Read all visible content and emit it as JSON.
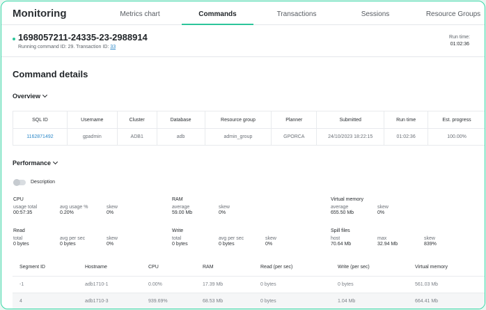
{
  "app": {
    "title": "Monitoring"
  },
  "tabs": [
    {
      "label": "Metrics chart",
      "active": false
    },
    {
      "label": "Commands",
      "active": true
    },
    {
      "label": "Transactions",
      "active": false
    },
    {
      "label": "Sessions",
      "active": false
    },
    {
      "label": "Resource Groups",
      "active": false
    }
  ],
  "command": {
    "id": "1698057211-24335-23-2988914",
    "subtitle_prefix": "Running command ID: 29. Transaction ID: ",
    "transaction_id": "33",
    "runtime_label": "Run time:",
    "runtime_value": "01:02:36"
  },
  "details": {
    "title": "Command details",
    "overview_label": "Overview",
    "performance_label": "Performance"
  },
  "overview": {
    "headers": [
      "SQL ID",
      "Username",
      "Cluster",
      "Database",
      "Resource group",
      "Planner",
      "Submitted",
      "Run time",
      "Est. progress"
    ],
    "row": [
      "1162871492",
      "gpadmin",
      "ADB1",
      "adb",
      "admin_group",
      "GPORCA",
      "24/10/2023 18:22:15",
      "01:02:36",
      "100.00%"
    ]
  },
  "toggle": {
    "label": "Description",
    "on": false
  },
  "performance": {
    "cpu": {
      "title": "CPU",
      "cols": [
        {
          "label": "usage total",
          "value": "00:57:35"
        },
        {
          "label": "avg usage %",
          "value": "0.20%"
        },
        {
          "label": "skew",
          "value": "0%"
        }
      ]
    },
    "ram": {
      "title": "RAM",
      "cols": [
        {
          "label": "average",
          "value": "59.00 Mb"
        },
        {
          "label": "skew",
          "value": "0%"
        }
      ]
    },
    "vmem": {
      "title": "Virtual memory",
      "cols": [
        {
          "label": "average",
          "value": "655.50 Mb"
        },
        {
          "label": "skew",
          "value": "0%"
        }
      ]
    },
    "read": {
      "title": "Read",
      "cols": [
        {
          "label": "total",
          "value": "0 bytes"
        },
        {
          "label": "avg per sec",
          "value": "0 bytes"
        },
        {
          "label": "skew",
          "value": "0%"
        }
      ]
    },
    "write": {
      "title": "Write",
      "cols": [
        {
          "label": "total",
          "value": "0 bytes"
        },
        {
          "label": "avg per sec",
          "value": "0 bytes"
        },
        {
          "label": "skew",
          "value": "0%"
        }
      ]
    },
    "spill": {
      "title": "Spill files",
      "cols": [
        {
          "label": "host",
          "value": "70.64 Mb"
        },
        {
          "label": "max",
          "value": "32.94 Mb"
        },
        {
          "label": "skew",
          "value": "839%"
        }
      ]
    }
  },
  "segments": {
    "headers": [
      "Segment ID",
      "Hostname",
      "CPU",
      "RAM",
      "Read (per sec)",
      "Write (per sec)",
      "Virtual memory"
    ],
    "rows": [
      [
        "-1",
        "adb1710-1",
        "0.00%",
        "17.39 Mb",
        "0 bytes",
        "0 bytes",
        "561.03 Mb"
      ],
      [
        "4",
        "adb1710-3",
        "939.69%",
        "68.53 Mb",
        "0 bytes",
        "1.04 Mb",
        "664.41 Mb"
      ]
    ]
  },
  "colors": {
    "accent": "#2cc59a",
    "link": "#2a87c8",
    "frame_border": "#37d7a6"
  }
}
